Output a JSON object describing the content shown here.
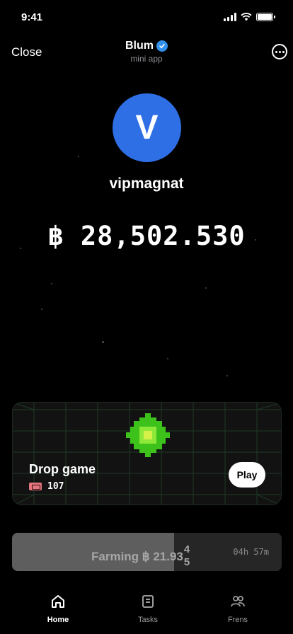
{
  "status_bar": {
    "time": "9:41"
  },
  "header": {
    "close_label": "Close",
    "title": "Blum",
    "subtitle": "mini app",
    "verified_icon": "verified-badge-icon",
    "more_icon": "more-options-icon"
  },
  "profile": {
    "avatar_letter": "V",
    "avatar_color": "#2f6fe6",
    "username": "vipmagnat"
  },
  "balance": {
    "text": "฿ 28,502.530"
  },
  "drop_game": {
    "title": "Drop game",
    "tickets": "107",
    "play_label": "Play",
    "accent": "#59d61e"
  },
  "farming": {
    "label": "Farming ฿ 21.93",
    "digit_top": "4",
    "digit_bottom": "5",
    "timer": "04h 57m",
    "progress": 0.6
  },
  "tabs": [
    {
      "label": "Home",
      "icon": "home-icon",
      "active": true
    },
    {
      "label": "Tasks",
      "icon": "tasks-icon",
      "active": false
    },
    {
      "label": "Frens",
      "icon": "frens-icon",
      "active": false
    }
  ]
}
